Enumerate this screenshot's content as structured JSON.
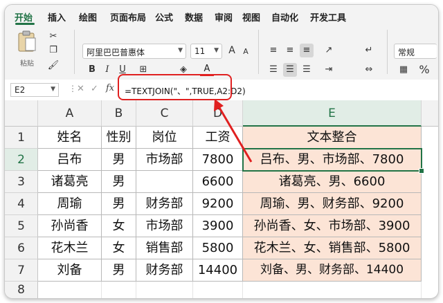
{
  "tabs": [
    "开始",
    "插入",
    "绘图",
    "页面布局",
    "公式",
    "数据",
    "审阅",
    "视图",
    "自动化",
    "开发工具"
  ],
  "ribbon": {
    "paste_label": "粘贴",
    "font_name": "阿里巴巴普惠体",
    "font_size": "11",
    "number_format": "常规",
    "bold": "B",
    "italic": "I",
    "underline": "U",
    "grow_font": "A",
    "shrink_font": "A",
    "font_color_letter": "A",
    "percent": "%"
  },
  "formula_bar": {
    "name_box": "E2",
    "fx": "fx",
    "formula": "=TEXTJOIN(\"、\",TRUE,A2:D2)"
  },
  "columns": [
    "A",
    "B",
    "C",
    "D",
    "E"
  ],
  "rows": [
    "1",
    "2",
    "3",
    "4",
    "5",
    "6",
    "7",
    "8"
  ],
  "table": [
    [
      "姓名",
      "性别",
      "岗位",
      "工资",
      "文本整合"
    ],
    [
      "吕布",
      "男",
      "市场部",
      "7800",
      "吕布、男、市场部、7800"
    ],
    [
      "诸葛亮",
      "男",
      "",
      "6600",
      "诸葛亮、男、6600"
    ],
    [
      "周瑜",
      "男",
      "财务部",
      "9200",
      "周瑜、男、财务部、9200"
    ],
    [
      "孙尚香",
      "女",
      "市场部",
      "3900",
      "孙尚香、女、市场部、3900"
    ],
    [
      "花木兰",
      "女",
      "销售部",
      "5800",
      "花木兰、女、销售部、5800"
    ],
    [
      "刘备",
      "男",
      "财务部",
      "14400",
      "刘备、男、财务部、14400"
    ]
  ],
  "colors": {
    "accent": "#217346",
    "highlight_fill": "#fce4d6",
    "annotation": "#e02020"
  }
}
